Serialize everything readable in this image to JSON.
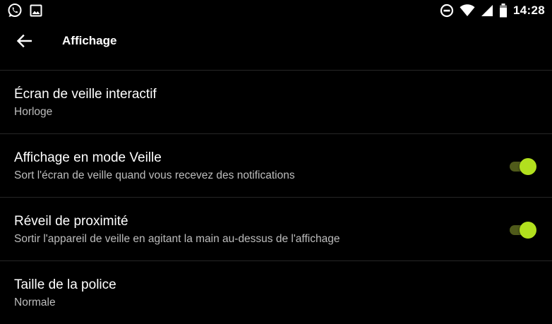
{
  "status_bar": {
    "time": "14:28",
    "left_icons": [
      "whatsapp-icon",
      "gallery-icon"
    ],
    "right_icons": [
      "data-saver-icon",
      "wifi-icon",
      "cell-signal-icon",
      "battery-icon"
    ]
  },
  "toolbar": {
    "back_icon": "arrow-left-icon",
    "title": "Affichage"
  },
  "settings": [
    {
      "title": "Écran de veille interactif",
      "summary": "Horloge"
    },
    {
      "title": "Affichage en mode Veille",
      "summary": "Sort l'écran de veille quand vous recevez des notifications",
      "toggle": true
    },
    {
      "title": "Réveil de proximité",
      "summary": "Sortir l'appareil de veille en agitant la main au-dessus de l'affichage",
      "toggle": true
    },
    {
      "title": "Taille de la police",
      "summary": "Normale"
    }
  ],
  "colors": {
    "background": "#000000",
    "divider": "#262626",
    "accent": "#b2e01e",
    "accent_track": "#4f5a1a",
    "summary_text": "#bdbdbd"
  }
}
